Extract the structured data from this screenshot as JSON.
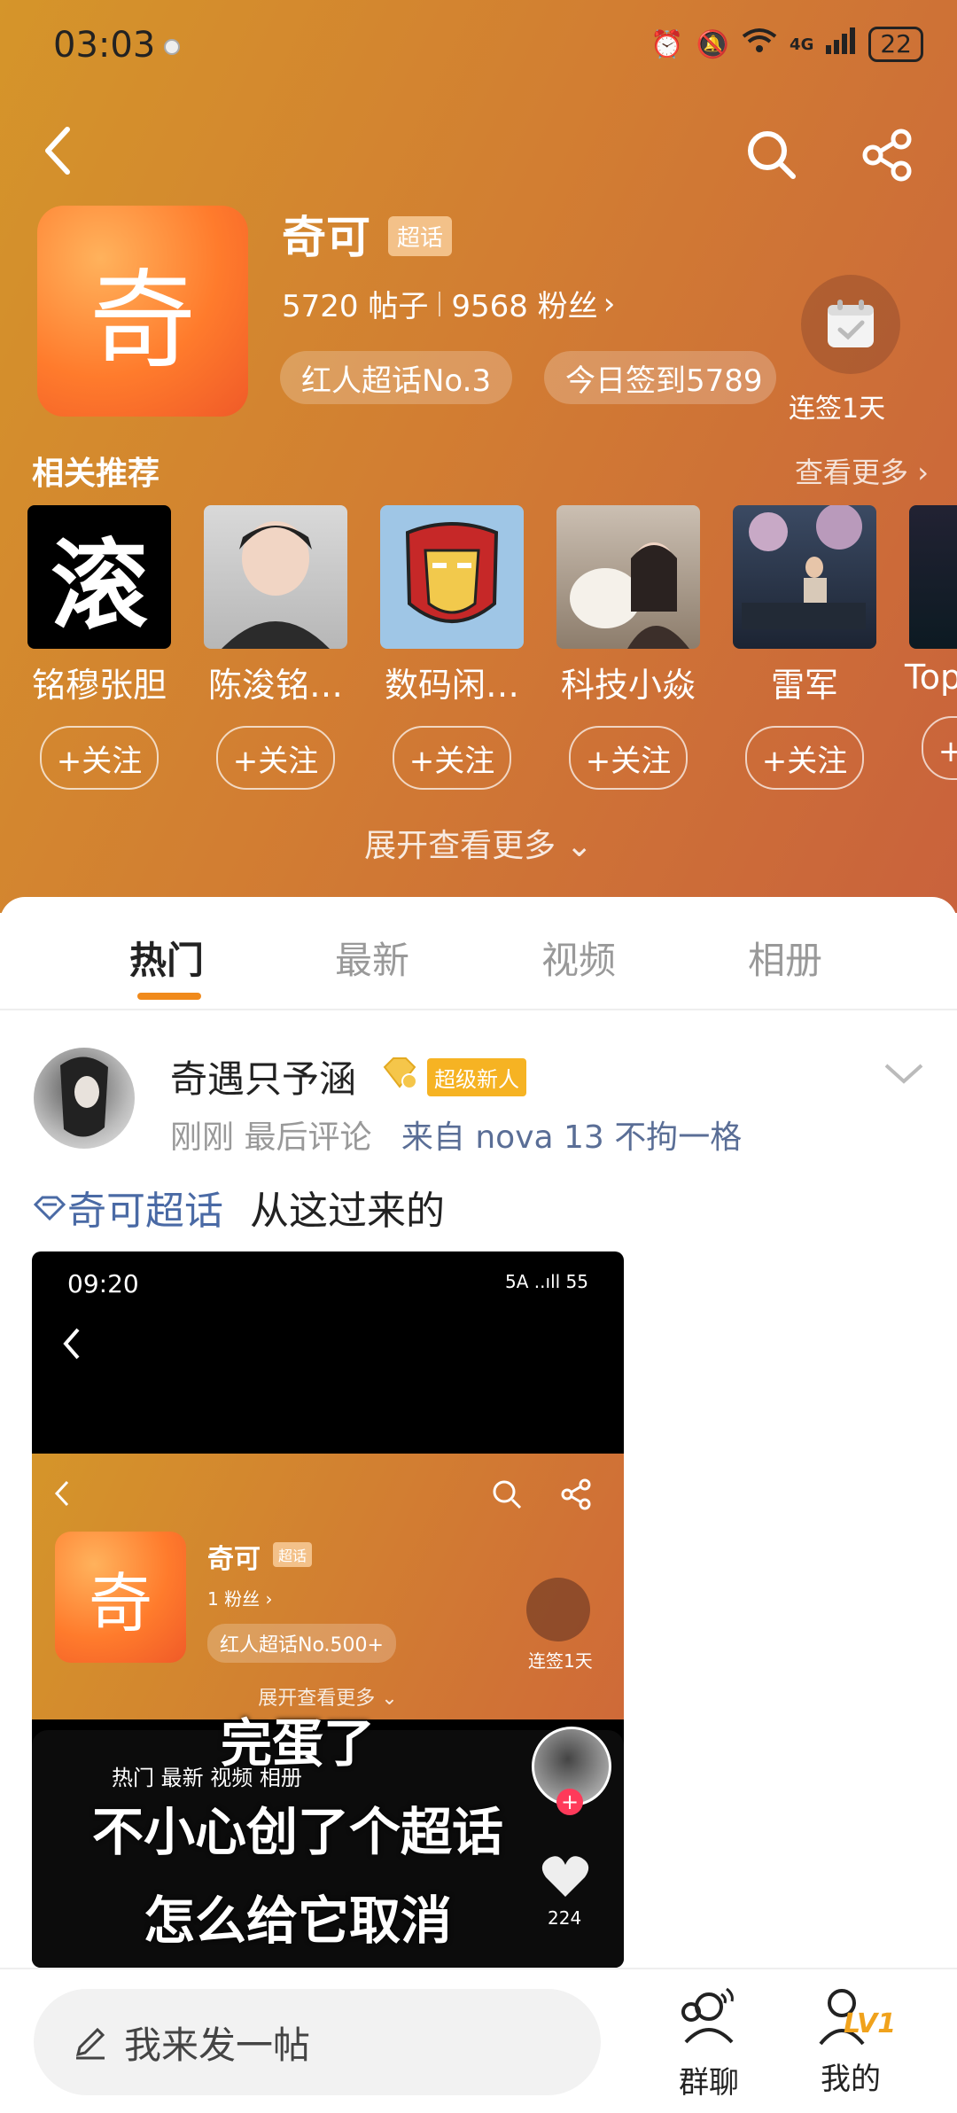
{
  "status_bar": {
    "time": "03:03",
    "signal": "4G",
    "battery": "22"
  },
  "supertopic": {
    "avatar_char": "奇",
    "name": "奇可",
    "badge": "超话",
    "posts": "5720 帖子",
    "fans": "9568 粉丝",
    "rank_pill": "红人超话No.3",
    "checkin_pill": "今日签到5789",
    "streak_label": "连签1天"
  },
  "recommendations": {
    "title": "相关推荐",
    "more_label": "查看更多 ›",
    "follow_label": "+关注",
    "items": [
      {
        "name": "铭穆张胆",
        "avatar_char": "滚"
      },
      {
        "name": "陈浚铭…"
      },
      {
        "name": "数码闲…"
      },
      {
        "name": "科技小焱"
      },
      {
        "name": "雷军"
      },
      {
        "name": "Top"
      }
    ],
    "expand_label": "展开查看更多"
  },
  "tabs": [
    {
      "label": "热门",
      "active": true
    },
    {
      "label": "最新",
      "active": false
    },
    {
      "label": "视频",
      "active": false
    },
    {
      "label": "相册",
      "active": false
    }
  ],
  "post": {
    "username": "奇遇只予涵",
    "user_tag": "超级新人",
    "meta_time": "刚刚 最后评论",
    "meta_source": "来自 nova 13 不拘一格",
    "topic": "奇可超话",
    "text": "从这过来的",
    "media": {
      "time": "09:20",
      "status": "5A ..ıll 55",
      "name": "奇可",
      "badge": "超话",
      "fans": "1 粉丝 ›",
      "pill": "红人超话No.500+",
      "checkin_label": "连签1天",
      "expand_label": "展开查看更多 ⌄",
      "tabs": "热门   最新   视频   相册",
      "caption_1": "完蛋了",
      "caption_2": "不小心创了个超话",
      "caption_3": "怎么给它取消",
      "like_count": "224"
    }
  },
  "bottom_bar": {
    "compose_placeholder": "我来发一帖",
    "group_chat_label": "群聊",
    "mine_label": "我的",
    "level": "LV1"
  },
  "colors": {
    "accent": "#f08a1c",
    "topic_blue": "#4a6aa5",
    "header_start": "#d5952a",
    "header_end": "#c9623c"
  }
}
